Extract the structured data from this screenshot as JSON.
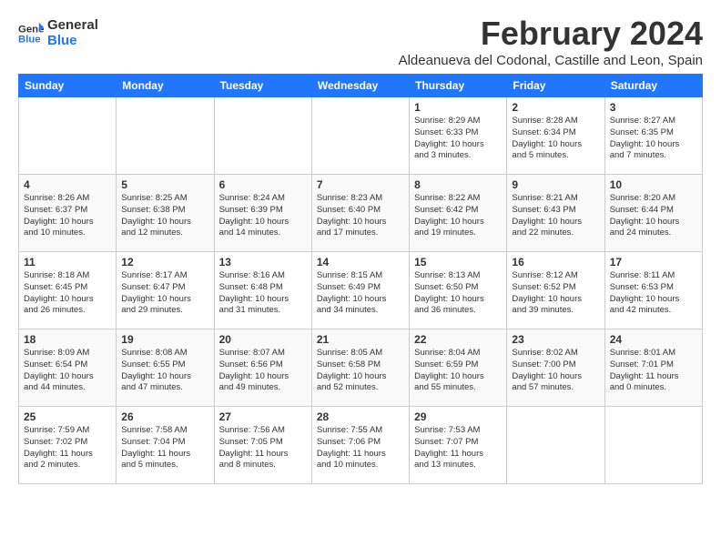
{
  "header": {
    "logo_line1": "General",
    "logo_line2": "Blue",
    "month_year": "February 2024",
    "location": "Aldeanueva del Codonal, Castille and Leon, Spain"
  },
  "days_of_week": [
    "Sunday",
    "Monday",
    "Tuesday",
    "Wednesday",
    "Thursday",
    "Friday",
    "Saturday"
  ],
  "weeks": [
    [
      {
        "day": "",
        "content": ""
      },
      {
        "day": "",
        "content": ""
      },
      {
        "day": "",
        "content": ""
      },
      {
        "day": "",
        "content": ""
      },
      {
        "day": "1",
        "content": "Sunrise: 8:29 AM\nSunset: 6:33 PM\nDaylight: 10 hours\nand 3 minutes."
      },
      {
        "day": "2",
        "content": "Sunrise: 8:28 AM\nSunset: 6:34 PM\nDaylight: 10 hours\nand 5 minutes."
      },
      {
        "day": "3",
        "content": "Sunrise: 8:27 AM\nSunset: 6:35 PM\nDaylight: 10 hours\nand 7 minutes."
      }
    ],
    [
      {
        "day": "4",
        "content": "Sunrise: 8:26 AM\nSunset: 6:37 PM\nDaylight: 10 hours\nand 10 minutes."
      },
      {
        "day": "5",
        "content": "Sunrise: 8:25 AM\nSunset: 6:38 PM\nDaylight: 10 hours\nand 12 minutes."
      },
      {
        "day": "6",
        "content": "Sunrise: 8:24 AM\nSunset: 6:39 PM\nDaylight: 10 hours\nand 14 minutes."
      },
      {
        "day": "7",
        "content": "Sunrise: 8:23 AM\nSunset: 6:40 PM\nDaylight: 10 hours\nand 17 minutes."
      },
      {
        "day": "8",
        "content": "Sunrise: 8:22 AM\nSunset: 6:42 PM\nDaylight: 10 hours\nand 19 minutes."
      },
      {
        "day": "9",
        "content": "Sunrise: 8:21 AM\nSunset: 6:43 PM\nDaylight: 10 hours\nand 22 minutes."
      },
      {
        "day": "10",
        "content": "Sunrise: 8:20 AM\nSunset: 6:44 PM\nDaylight: 10 hours\nand 24 minutes."
      }
    ],
    [
      {
        "day": "11",
        "content": "Sunrise: 8:18 AM\nSunset: 6:45 PM\nDaylight: 10 hours\nand 26 minutes."
      },
      {
        "day": "12",
        "content": "Sunrise: 8:17 AM\nSunset: 6:47 PM\nDaylight: 10 hours\nand 29 minutes."
      },
      {
        "day": "13",
        "content": "Sunrise: 8:16 AM\nSunset: 6:48 PM\nDaylight: 10 hours\nand 31 minutes."
      },
      {
        "day": "14",
        "content": "Sunrise: 8:15 AM\nSunset: 6:49 PM\nDaylight: 10 hours\nand 34 minutes."
      },
      {
        "day": "15",
        "content": "Sunrise: 8:13 AM\nSunset: 6:50 PM\nDaylight: 10 hours\nand 36 minutes."
      },
      {
        "day": "16",
        "content": "Sunrise: 8:12 AM\nSunset: 6:52 PM\nDaylight: 10 hours\nand 39 minutes."
      },
      {
        "day": "17",
        "content": "Sunrise: 8:11 AM\nSunset: 6:53 PM\nDaylight: 10 hours\nand 42 minutes."
      }
    ],
    [
      {
        "day": "18",
        "content": "Sunrise: 8:09 AM\nSunset: 6:54 PM\nDaylight: 10 hours\nand 44 minutes."
      },
      {
        "day": "19",
        "content": "Sunrise: 8:08 AM\nSunset: 6:55 PM\nDaylight: 10 hours\nand 47 minutes."
      },
      {
        "day": "20",
        "content": "Sunrise: 8:07 AM\nSunset: 6:56 PM\nDaylight: 10 hours\nand 49 minutes."
      },
      {
        "day": "21",
        "content": "Sunrise: 8:05 AM\nSunset: 6:58 PM\nDaylight: 10 hours\nand 52 minutes."
      },
      {
        "day": "22",
        "content": "Sunrise: 8:04 AM\nSunset: 6:59 PM\nDaylight: 10 hours\nand 55 minutes."
      },
      {
        "day": "23",
        "content": "Sunrise: 8:02 AM\nSunset: 7:00 PM\nDaylight: 10 hours\nand 57 minutes."
      },
      {
        "day": "24",
        "content": "Sunrise: 8:01 AM\nSunset: 7:01 PM\nDaylight: 11 hours\nand 0 minutes."
      }
    ],
    [
      {
        "day": "25",
        "content": "Sunrise: 7:59 AM\nSunset: 7:02 PM\nDaylight: 11 hours\nand 2 minutes."
      },
      {
        "day": "26",
        "content": "Sunrise: 7:58 AM\nSunset: 7:04 PM\nDaylight: 11 hours\nand 5 minutes."
      },
      {
        "day": "27",
        "content": "Sunrise: 7:56 AM\nSunset: 7:05 PM\nDaylight: 11 hours\nand 8 minutes."
      },
      {
        "day": "28",
        "content": "Sunrise: 7:55 AM\nSunset: 7:06 PM\nDaylight: 11 hours\nand 10 minutes."
      },
      {
        "day": "29",
        "content": "Sunrise: 7:53 AM\nSunset: 7:07 PM\nDaylight: 11 hours\nand 13 minutes."
      },
      {
        "day": "",
        "content": ""
      },
      {
        "day": "",
        "content": ""
      }
    ]
  ]
}
